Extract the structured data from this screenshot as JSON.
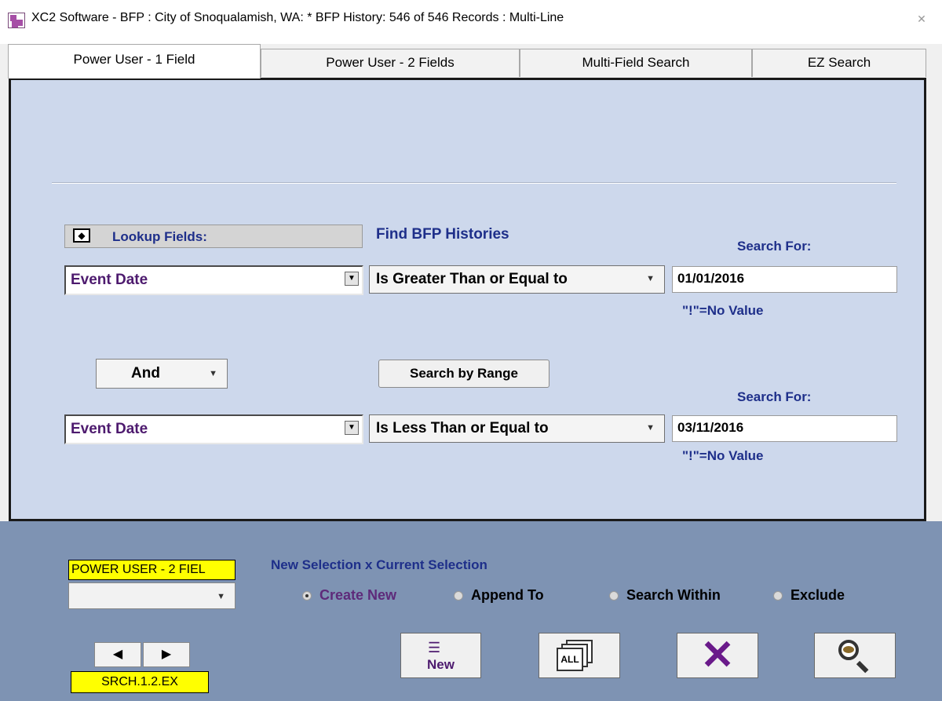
{
  "window": {
    "title": "XC2 Software - BFP : City of Snoqualamish, WA: * BFP History: 546 of 546 Records : Multi-Line",
    "close_icon": "close-icon"
  },
  "tabs": [
    {
      "label": "Power User - 1 Field",
      "active": true
    },
    {
      "label": "Power User - 2 Fields",
      "active": false
    },
    {
      "label": "Multi-Field Search",
      "active": false
    },
    {
      "label": "EZ Search",
      "active": false
    }
  ],
  "search": {
    "lookup_label": "Lookup Fields:",
    "find_label": "Find BFP Histories",
    "search_for_label": "Search For:",
    "no_value_hint": "\"!\"=No Value",
    "row1": {
      "field": "Event Date",
      "operator": "Is Greater Than or Equal to",
      "value": "01/01/2016"
    },
    "conjunction": "And",
    "range_button": "Search by Range",
    "row2": {
      "field": "Event Date",
      "operator": "Is Less Than or Equal to",
      "value": "03/11/2016"
    }
  },
  "bottom": {
    "preset_label": "POWER USER - 2 FIEL",
    "preset_value": "",
    "srch_label": "SRCH.1.2.EX",
    "selection_heading": "New Selection x Current Selection",
    "radios": [
      {
        "label": "Create New",
        "selected": true
      },
      {
        "label": "Append To",
        "selected": false
      },
      {
        "label": "Search Within",
        "selected": false
      },
      {
        "label": "Exclude",
        "selected": false
      }
    ],
    "new_button_label": "New",
    "all_button_label": "ALL"
  },
  "colors": {
    "panel_bg": "#cdd8ec",
    "bottom_bg": "#7e93b3",
    "label_navy": "#1e2f8a",
    "field_purple": "#4d1a6e",
    "highlight_yellow": "#ffff00"
  }
}
